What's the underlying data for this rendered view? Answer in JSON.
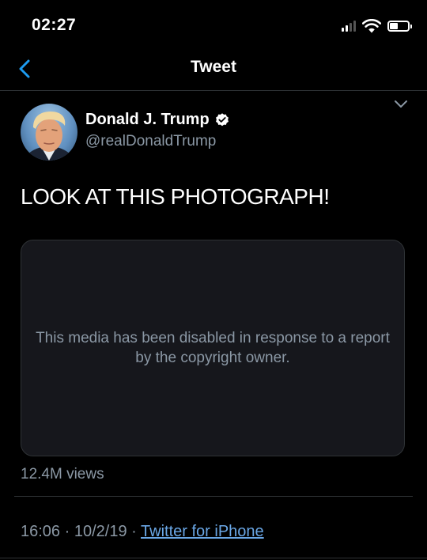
{
  "status_bar": {
    "time": "02:27",
    "signal_icon": "cellular-signal-icon",
    "wifi_icon": "wifi-icon",
    "battery_icon": "battery-icon",
    "battery_level": 0.45
  },
  "nav": {
    "back_icon": "chevron-left-icon",
    "title": "Tweet"
  },
  "tweet": {
    "menu_icon": "chevron-down-icon",
    "author": {
      "name": "Donald J. Trump",
      "handle": "@realDonaldTrump",
      "verified_icon": "verified-badge-icon"
    },
    "text": "LOOK AT THIS PHOTOGRAPH!",
    "media_message": "This media has been disabled in response to a report by the copyright owner.",
    "views": "12.4M views",
    "time": "16:06",
    "date": "10/2/19",
    "separator": "·",
    "source": "Twitter for iPhone"
  },
  "colors": {
    "background": "#000000",
    "text_primary": "#ffffff",
    "text_secondary": "#8b98a5",
    "accent": "#1d9bf0",
    "link": "#6aa7e6",
    "divider": "#2f3336",
    "media_bg": "#16171c"
  }
}
